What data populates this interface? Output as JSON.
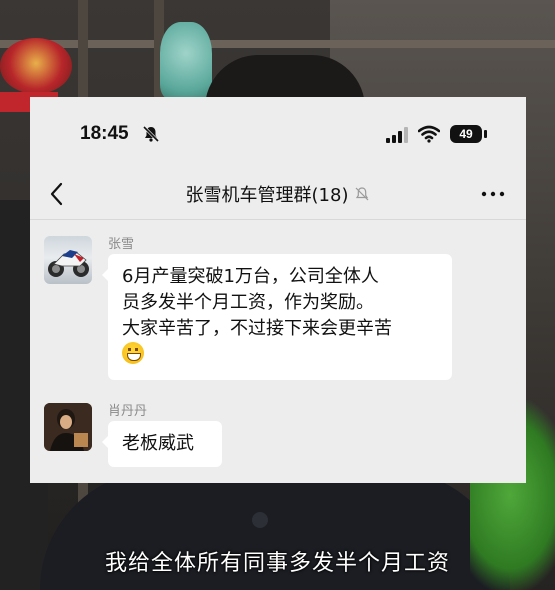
{
  "status_bar": {
    "time": "18:45",
    "battery": "49",
    "icons": [
      "bell-off-icon",
      "cellular-signal-icon",
      "wifi-icon",
      "battery-icon"
    ]
  },
  "chat_header": {
    "title": "张雪机车管理群(18)",
    "back_icon": "chevron-left-icon",
    "mute_icon": "bell-off-icon",
    "more_icon": "more-horizontal-icon"
  },
  "messages": [
    {
      "sender": "张雪",
      "avatar": "motorcycle-photo",
      "lines": [
        "6月产量突破1万台，公司全体人",
        "员多发半个月工资，作为奖励。",
        "大家辛苦了，不过接下来会更辛苦"
      ],
      "emoji": "grinning-face-emoji"
    },
    {
      "sender": "肖丹丹",
      "avatar": "person-photo",
      "lines": [
        "老板威武"
      ]
    }
  ],
  "video_subtitle": "我给全体所有同事多发半个月工资",
  "colors": {
    "chat_background": "#ededed",
    "bubble": "#ffffff",
    "sender_name": "#8a8a8a"
  }
}
